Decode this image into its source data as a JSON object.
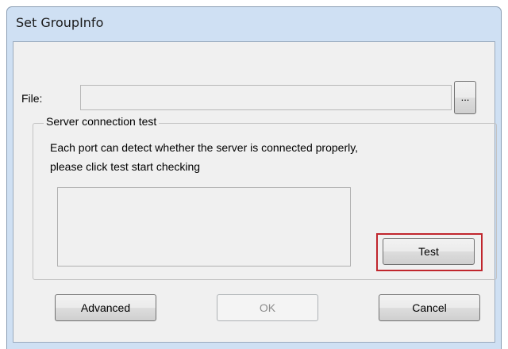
{
  "window": {
    "title": "Set GroupInfo"
  },
  "file": {
    "label": "File:",
    "value": "",
    "browse_label": "..."
  },
  "server_test": {
    "group_title": "Server connection test",
    "description_line1": "Each port can detect whether the server is connected properly,",
    "description_line2": "please click test start checking",
    "result_text": "",
    "test_label": "Test"
  },
  "footer": {
    "advanced_label": "Advanced",
    "ok_label": "OK",
    "cancel_label": "Cancel"
  },
  "colors": {
    "highlight": "#c0262d",
    "frame": "#cfe0f3",
    "client_bg": "#f0f0f0"
  }
}
